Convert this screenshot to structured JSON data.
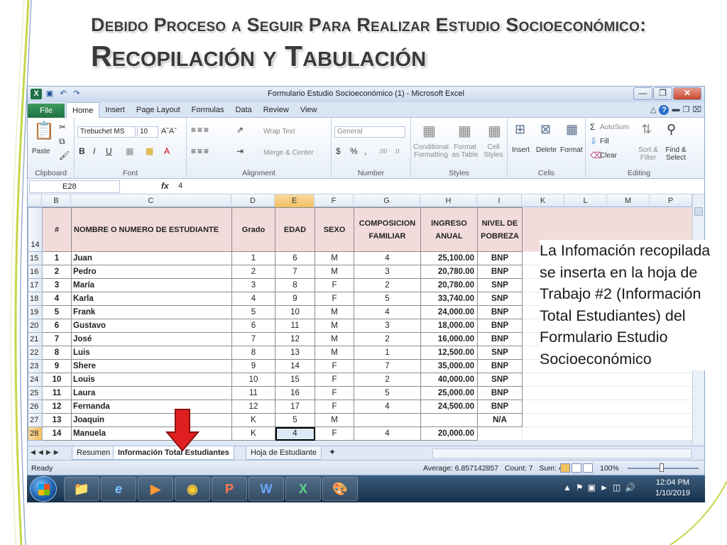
{
  "slide": {
    "title_line1": "Debido Proceso a Seguir Para Realizar Estudio Socioeconómico:",
    "title_line2": "Recopilación y Tabulación",
    "note": "La Infomación recopilada se inserta en la hoja de Trabajo #2 (Información Total Estudiantes) del Formulario Estudio Socioeconómico"
  },
  "excel": {
    "window_title": "Formulario Estudio Socioeconómico  (1)  -  Microsoft Excel",
    "tabs": [
      "File",
      "Home",
      "Insert",
      "Page Layout",
      "Formulas",
      "Data",
      "Review",
      "View"
    ],
    "active_tab": "Home",
    "ribbon": {
      "paste": "Paste",
      "clipboard": "Clipboard",
      "font_name": "Trebuchet MS",
      "font_size": "10",
      "font": "Font",
      "wrap_text": "Wrap Text",
      "merge_center": "Merge & Center",
      "alignment": "Alignment",
      "number_format": "General",
      "number": "Number",
      "conditional_formatting": "Conditional Formatting",
      "format_as_table": "Format as Table",
      "cell_styles": "Cell Styles",
      "styles": "Styles",
      "insert": "Insert",
      "delete": "Delete",
      "format": "Format",
      "cells": "Cells",
      "autosum": "AutoSum",
      "fill": "Fill",
      "clear": "Clear",
      "sort_filter": "Sort & Filter",
      "find_select": "Find & Select",
      "editing": "Editing"
    },
    "name_box": "E28",
    "formula_value": "4",
    "columns": [
      "B",
      "C",
      "D",
      "E",
      "F",
      "G",
      "H",
      "I",
      "K",
      "L",
      "M",
      "P"
    ],
    "selected_column": "E",
    "header_row_number": "14",
    "headers": [
      "#",
      "NOMBRE O NUMERO DE ESTUDIANTE",
      "Grado",
      "EDAD",
      "SEXO",
      "COMPOSICION FAMILIAR",
      "INGRESO ANUAL",
      "NIVEL DE POBREZA"
    ],
    "rows": [
      {
        "row": "15",
        "num": "1",
        "name": "Juan",
        "grado": "1",
        "edad": "6",
        "sexo": "M",
        "comp": "4",
        "ingreso": "25,100.00",
        "nivel": "BNP"
      },
      {
        "row": "16",
        "num": "2",
        "name": "Pedro",
        "grado": "2",
        "edad": "7",
        "sexo": "M",
        "comp": "3",
        "ingreso": "20,780.00",
        "nivel": "BNP"
      },
      {
        "row": "17",
        "num": "3",
        "name": "María",
        "grado": "3",
        "edad": "8",
        "sexo": "F",
        "comp": "2",
        "ingreso": "20,780.00",
        "nivel": "SNP"
      },
      {
        "row": "18",
        "num": "4",
        "name": "Karla",
        "grado": "4",
        "edad": "9",
        "sexo": "F",
        "comp": "5",
        "ingreso": "33,740.00",
        "nivel": "SNP"
      },
      {
        "row": "19",
        "num": "5",
        "name": "Frank",
        "grado": "5",
        "edad": "10",
        "sexo": "M",
        "comp": "4",
        "ingreso": "24,000.00",
        "nivel": "BNP"
      },
      {
        "row": "20",
        "num": "6",
        "name": "Gustavo",
        "grado": "6",
        "edad": "11",
        "sexo": "M",
        "comp": "3",
        "ingreso": "18,000.00",
        "nivel": "BNP"
      },
      {
        "row": "21",
        "num": "7",
        "name": "José",
        "grado": "7",
        "edad": "12",
        "sexo": "M",
        "comp": "2",
        "ingreso": "16,000.00",
        "nivel": "BNP"
      },
      {
        "row": "22",
        "num": "8",
        "name": "Luis",
        "grado": "8",
        "edad": "13",
        "sexo": "M",
        "comp": "1",
        "ingreso": "12,500.00",
        "nivel": "SNP"
      },
      {
        "row": "23",
        "num": "9",
        "name": "Shere",
        "grado": "9",
        "edad": "14",
        "sexo": "F",
        "comp": "7",
        "ingreso": "35,000.00",
        "nivel": "BNP"
      },
      {
        "row": "24",
        "num": "10",
        "name": "Louis",
        "grado": "10",
        "edad": "15",
        "sexo": "F",
        "comp": "2",
        "ingreso": "40,000.00",
        "nivel": "SNP"
      },
      {
        "row": "25",
        "num": "11",
        "name": "Laura",
        "grado": "11",
        "edad": "16",
        "sexo": "F",
        "comp": "5",
        "ingreso": "25,000.00",
        "nivel": "BNP"
      },
      {
        "row": "26",
        "num": "12",
        "name": "Fernanda",
        "grado": "12",
        "edad": "17",
        "sexo": "F",
        "comp": "4",
        "ingreso": "24,500.00",
        "nivel": "BNP"
      },
      {
        "row": "27",
        "num": "13",
        "name": "Joaquin",
        "grado": "K",
        "edad": "5",
        "sexo": "M",
        "comp": "",
        "ingreso": "",
        "nivel": "N/A"
      },
      {
        "row": "28",
        "num": "14",
        "name": "Manuela",
        "grado": "K",
        "edad": "4",
        "sexo": "F",
        "comp": "4",
        "ingreso": "20,000.00",
        "nivel": ""
      }
    ],
    "selected_row": "28",
    "sheet_tabs": [
      "Resumen",
      "Información Total Estudiantes",
      "Hoja de Estudiante"
    ],
    "active_sheet": "Información Total Estudiantes",
    "status": {
      "ready": "Ready",
      "average": "Average: 6.857142857",
      "count": "Count: 7",
      "sum": "Sum: 48",
      "zoom": "100%"
    }
  },
  "taskbar": {
    "time": "12:04 PM",
    "date": "1/10/2019"
  },
  "colors": {
    "header_fill": "#f2dcdb",
    "excel_green": "#1e7145",
    "arrow_red": "#e02020"
  }
}
